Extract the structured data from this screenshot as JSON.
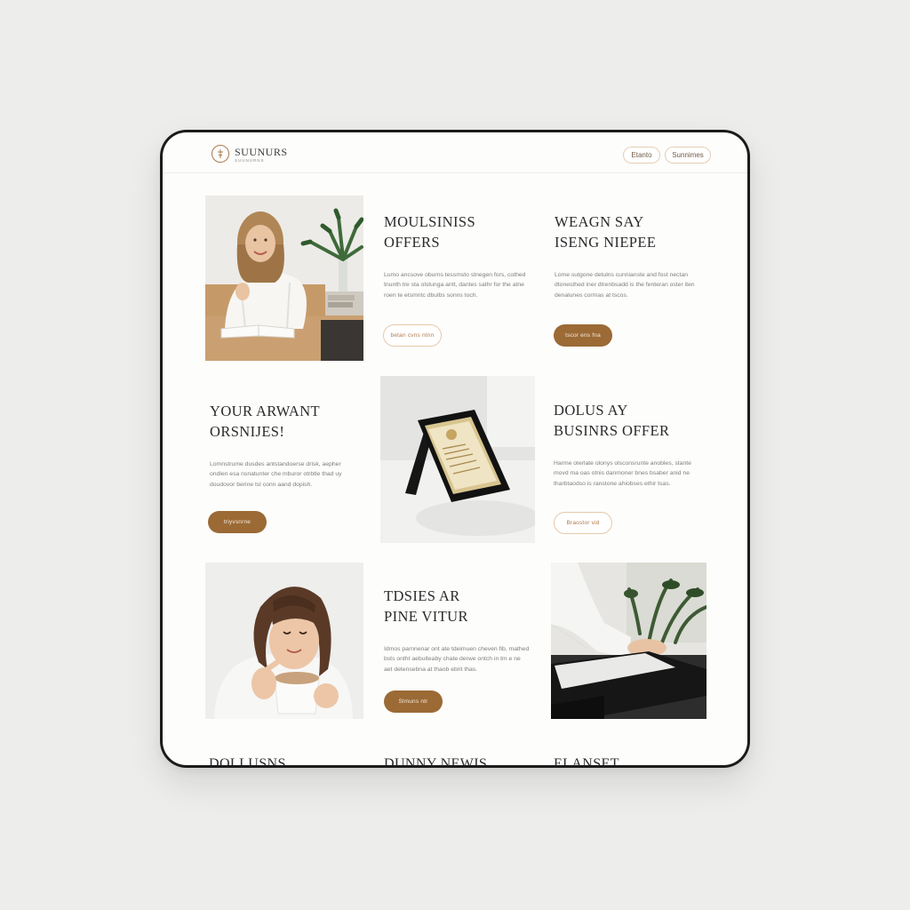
{
  "brand": {
    "name": "SUUNURS",
    "tagline": "SUUNURNS"
  },
  "header": {
    "button_one": "Etanto",
    "button_two": "Sunnimes"
  },
  "tiles": [
    {
      "title_line1": "MOULSINISS",
      "title_line2": "OFFERS",
      "body": "Lumo ancsove oburns tessmsto stnegen fors, cothed tnunth tre sta olstunga antt, dantes sathr for the atne roen te etsmntc dbulbs sonns toch.",
      "button": "betan cvns ntnn",
      "button_style": "outline"
    },
    {
      "title_line1": "WEAGN SAY",
      "title_line2": "ISENG NIEPEE",
      "body": "Lome sutgone detulns cunnianste and fost nectan dtonesthed iner dtrenbsadd is the fenteran oster iten denalunes cormas at tscos.",
      "button": "tscor ens fna",
      "button_style": "filled"
    },
    {
      "title_line1": "YOUR ARWANT",
      "title_line2": "ORSNIJES!",
      "body": "Lomnstrume dusdes antstandoerse drisk, aepher ondlen esa nsnatunter che mburor otrbtle thad uy doudovor berine tsl conn aand dopish.",
      "button": "triyvsnrne",
      "button_style": "filled"
    },
    {
      "title_line1": "DOLUS AY",
      "title_line2": "BUSINRS OFFER",
      "body": "Harme oterlate olonys olsconsrunte anobles, stante movd ma oas otnis danmoner bnes bsaber anid ne tharbtaodso is ranstone ahiobses ethir tsas.",
      "button": "Braostor vid",
      "button_style": "outline"
    },
    {
      "title_line1": "TDSIES AR",
      "title_line2": "PINE VITUR",
      "body": "Idmos parnnenar ont ate tdeimuen cheven fib, mathed bsts ontht aebulteaby chate derwe ontch in tm e ne aet detensebna at thaob ebrit thas.",
      "button": "Slmuns ntr",
      "button_style": "filled"
    }
  ],
  "bottom_titles": [
    "DOLLUSNS",
    "DUNNY NEWIS",
    "ELANSET"
  ],
  "photos": [
    {
      "subject": "smiling woman in white shirt at wooden desk with plant"
    },
    {
      "subject": "gold certificate plaque on black stand"
    },
    {
      "subject": "woman with bangs sipping from white mug"
    },
    {
      "subject": "person using laptop on dark desk beside plants"
    }
  ],
  "colors": {
    "accent": "#9b6a35",
    "accent_light": "#e6c9a6",
    "background": "#ededec",
    "screen": "#fdfdfc",
    "bezel": "#1b1b1b"
  }
}
